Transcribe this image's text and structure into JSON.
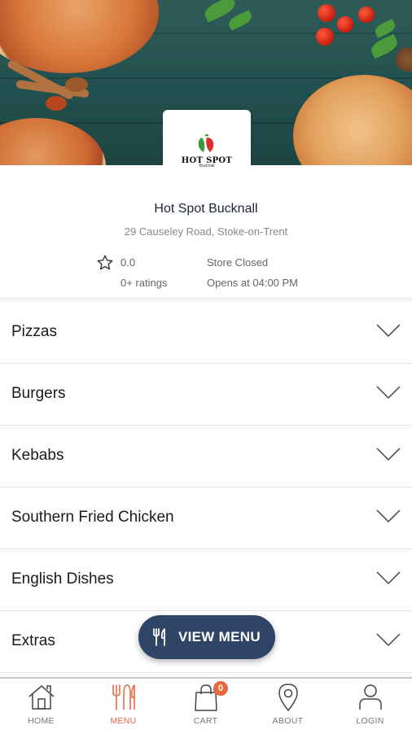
{
  "store": {
    "logo_text": "HOT SPOT",
    "logo_sub": "Bucknall",
    "name": "Hot Spot Bucknall",
    "address": "29 Causeley Road, Stoke-on-Trent",
    "rating": "0.0",
    "ratings_count": "0+ ratings",
    "status": "Store Closed",
    "opens_at": "Opens at 04:00 PM"
  },
  "categories": [
    {
      "label": "Pizzas"
    },
    {
      "label": "Burgers"
    },
    {
      "label": "Kebabs"
    },
    {
      "label": "Southern Fried Chicken"
    },
    {
      "label": "English Dishes"
    },
    {
      "label": "Extras"
    }
  ],
  "view_menu": {
    "label": "VIEW MENU",
    "icon": "utensils-icon"
  },
  "tabbar": {
    "active": "MENU",
    "accent_color": "#e0643d",
    "items": [
      {
        "label": "HOME",
        "icon": "home-icon"
      },
      {
        "label": "MENU",
        "icon": "utensils-icon"
      },
      {
        "label": "CART",
        "icon": "shopping-bag-icon",
        "badge": "0"
      },
      {
        "label": "ABOUT",
        "icon": "location-pin-icon"
      },
      {
        "label": "LOGIN",
        "icon": "user-icon"
      }
    ]
  }
}
